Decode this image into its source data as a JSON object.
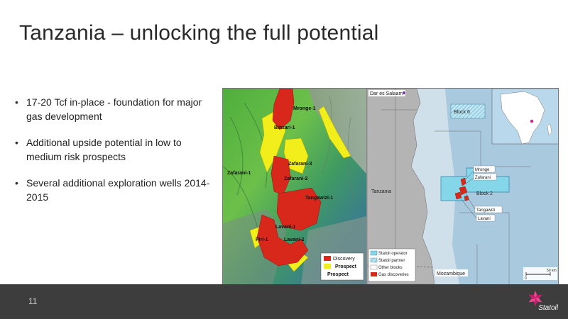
{
  "slide": {
    "title": "Tanzania – unlocking the full potential",
    "page_number": "11",
    "bullets": [
      "17-20 Tcf in-place - foundation for major gas development",
      "Additional upside potential in low to medium risk prospects",
      "Several additional exploration wells 2014-2015"
    ]
  },
  "left_map": {
    "well_labels": {
      "mronge": "Mronge-1",
      "binzari": "Binzari-1",
      "zafarani3": "Zafarani-3",
      "zafarani1": "Zafarani-1",
      "zafarani2": "Zafarani-2",
      "tangawizi": "Tangawizi-1",
      "lavani1": "Lavani-1",
      "piri": "Piri-1",
      "lavani2": "Lavani-2"
    },
    "legend": {
      "discovery": "Discovery",
      "prospect": "Prospect",
      "prospect2": "Prospect"
    },
    "colors": {
      "discovery": "#d8281c",
      "prospect": "#f2ee1c"
    }
  },
  "right_map": {
    "labels": {
      "dar_es_salaam": "Dar es Salaam",
      "block6": "Block 6",
      "tanzania": "Tanzania",
      "block2": "Block 2",
      "mronge": "Mronge",
      "zafarani": "Zafarani",
      "tangawizi": "Tangawizi",
      "lavani": "Lavani",
      "mozambique": "Mozambique",
      "scale": "50 km",
      "scale_zero": "0"
    },
    "legend": {
      "operator": "Statoil operator",
      "partner": "Statoil partner",
      "other": "Other blocks",
      "gas": "Gas discoveries"
    }
  },
  "footer": {
    "logo_text": "Statoil",
    "logo_icon": "statoil-star-icon"
  }
}
